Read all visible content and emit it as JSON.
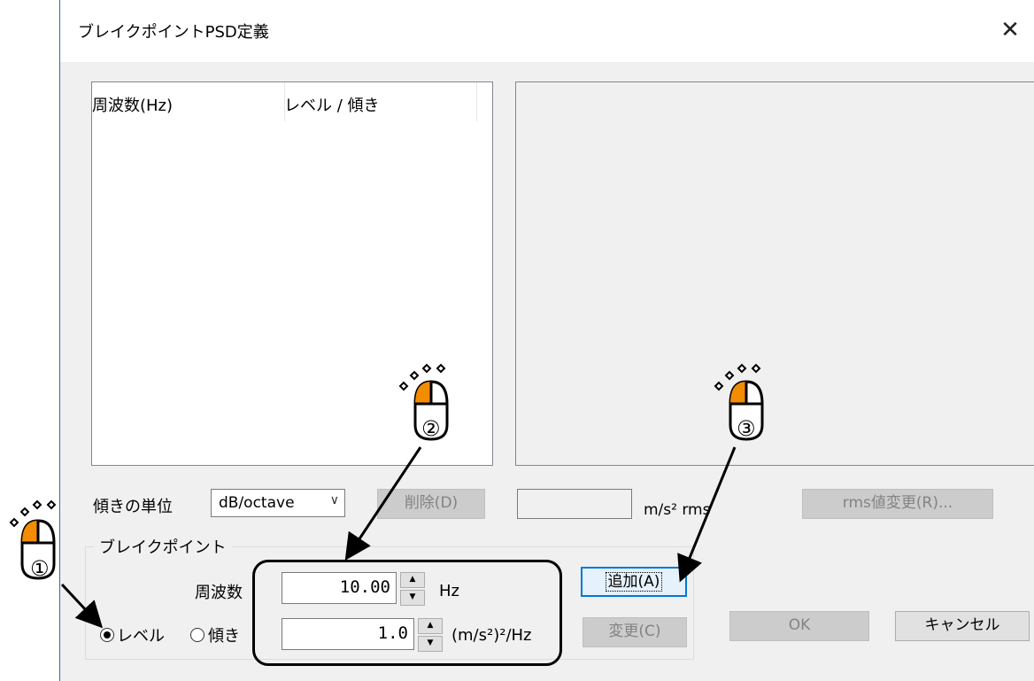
{
  "dialog": {
    "title": "ブレイクポイントPSD定義",
    "close_glyph": "✕"
  },
  "listview": {
    "columns": [
      "周波数(Hz)",
      "レベル / 傾き"
    ]
  },
  "slope_unit": {
    "label": "傾きの単位",
    "selected": "dB/octave",
    "chevron": "∨"
  },
  "buttons": {
    "delete": "削除(D)",
    "rms_change": "rms値変更(R)...",
    "add": "追加(A)",
    "modify": "変更(C)",
    "ok": "OK",
    "cancel": "キャンセル"
  },
  "rms": {
    "value": "",
    "unit": "m/s² rms"
  },
  "breakpoint": {
    "group_label": "ブレイクポイント",
    "freq_label": "周波数",
    "freq_value": "10.00",
    "freq_unit": "Hz",
    "level_value": "1.0",
    "level_unit": "(m/s²)²/Hz",
    "radio_level": "レベル",
    "radio_slope": "傾き",
    "selected_mode": "level"
  },
  "annotations": {
    "step_labels": [
      "①",
      "②",
      "③"
    ]
  },
  "colors": {
    "accent": "#0078d7",
    "mouse_highlight": "#f28c00"
  }
}
